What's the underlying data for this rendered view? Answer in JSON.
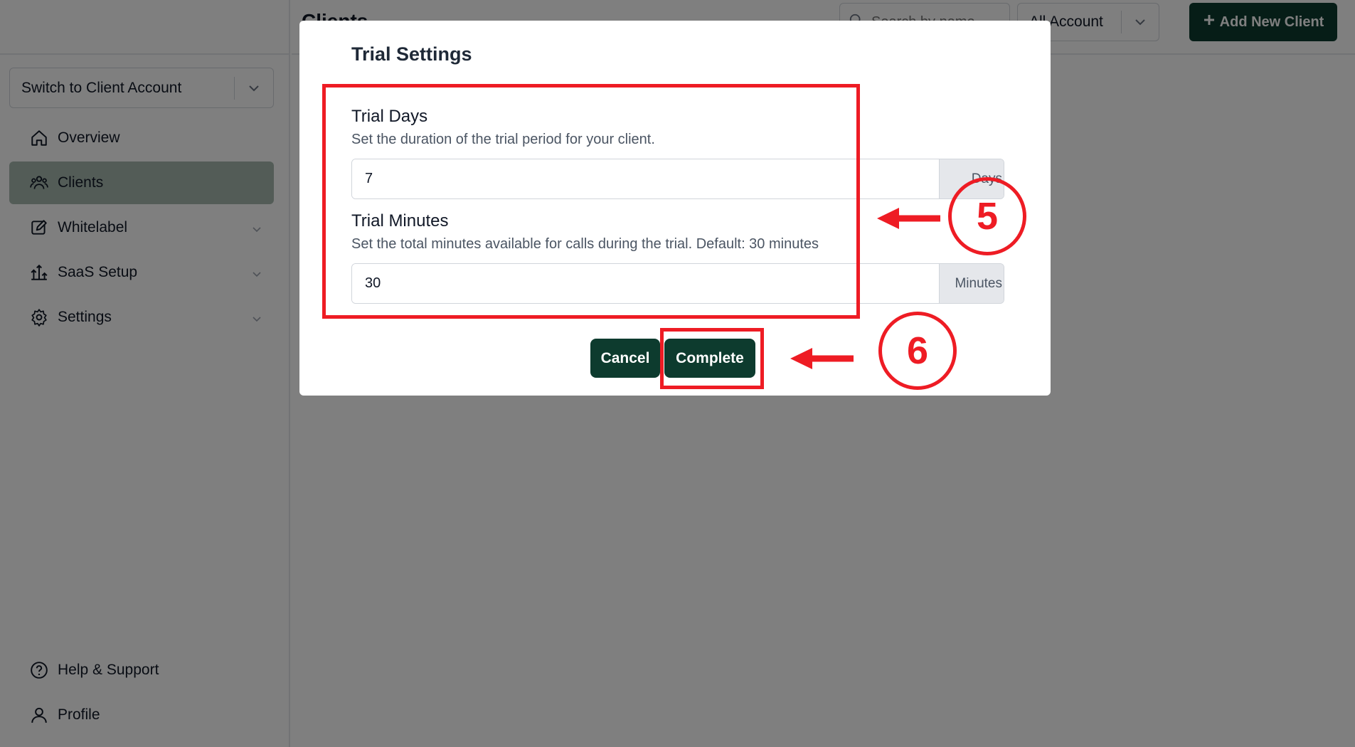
{
  "sidebar": {
    "account_switch_label": "Switch to Client Account",
    "items": [
      {
        "label": "Overview",
        "icon": "home-icon"
      },
      {
        "label": "Clients",
        "icon": "users-icon",
        "active": true
      },
      {
        "label": "Whitelabel",
        "icon": "edit-icon"
      },
      {
        "label": "SaaS Setup",
        "icon": "setup-icon"
      },
      {
        "label": "Settings",
        "icon": "gear-icon"
      }
    ],
    "bottom_items": [
      {
        "label": "Help & Support",
        "icon": "help-icon"
      },
      {
        "label": "Profile",
        "icon": "user-icon"
      }
    ]
  },
  "header": {
    "title": "Clients",
    "search_placeholder": "Search by name",
    "account_filter": "All Account",
    "add_button": "Add New Client"
  },
  "modal": {
    "title": "Trial Settings",
    "trial_days": {
      "label": "Trial Days",
      "help": "Set the duration of the trial period for your client.",
      "value": "7",
      "unit": "Days"
    },
    "trial_minutes": {
      "label": "Trial Minutes",
      "help": "Set the total minutes available for calls during the trial. Default: 30 minutes",
      "value": "30",
      "unit": "Minutes"
    },
    "cancel_label": "Cancel",
    "complete_label": "Complete"
  },
  "annotations": {
    "step_a": "5",
    "step_b": "6",
    "color": "#ee1c24"
  },
  "colors": {
    "brand": "#0d3b2e",
    "active_nav": "#a7b9ae"
  }
}
